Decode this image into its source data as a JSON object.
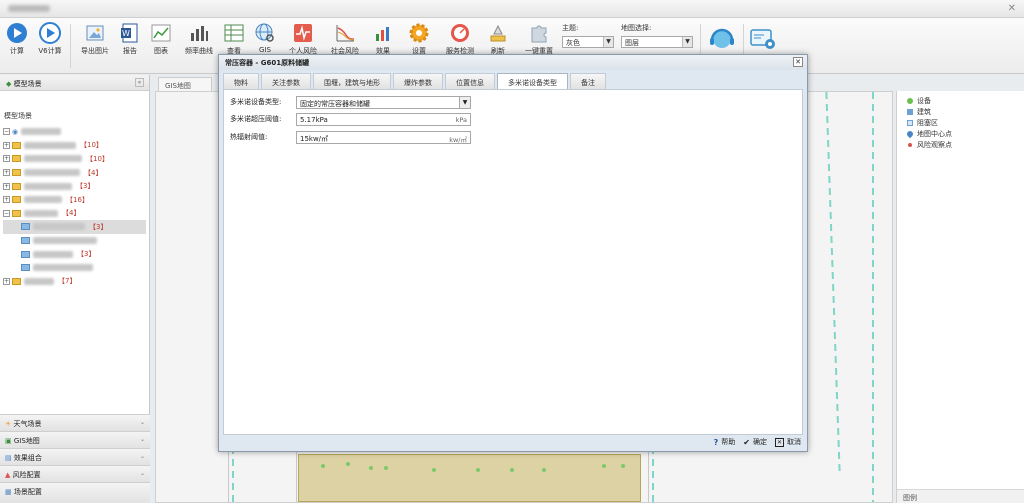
{
  "toolbar": {
    "items": [
      {
        "label": "计算",
        "icon": "play-icon"
      },
      {
        "label": "V6计算",
        "icon": "play-icon"
      },
      {
        "label": "导出图片",
        "icon": "image-icon"
      },
      {
        "label": "报告",
        "icon": "word-icon"
      },
      {
        "label": "图表",
        "icon": "chart-icon"
      },
      {
        "label": "频率曲线",
        "icon": "bar-chart-icon"
      },
      {
        "label": "查看",
        "icon": "table-icon"
      },
      {
        "label": "GIS",
        "icon": "globe-icon"
      },
      {
        "label": "个人风险",
        "icon": "pulse-icon"
      },
      {
        "label": "社会风险",
        "icon": "curve-icon"
      },
      {
        "label": "效果",
        "icon": "effect-icon"
      },
      {
        "label": "设置",
        "icon": "gear-icon"
      },
      {
        "label": "服务检测",
        "icon": "speedometer-icon"
      },
      {
        "label": "刷新",
        "icon": "refresh-icon"
      },
      {
        "label": "一键重置",
        "icon": "puzzle-icon"
      }
    ],
    "theme_label": "主题:",
    "theme_value": "灰色",
    "map_label": "地图选择:",
    "map_value": "图层"
  },
  "left_panel": {
    "header": "模型场景",
    "tree_title": "模型场景",
    "counts": [
      "10",
      "10",
      "4",
      "3",
      "16",
      "4",
      "3",
      "3",
      "7"
    ],
    "accordion": [
      "天气场景",
      "GIS地图",
      "效果组合",
      "风险配置",
      "场景配置"
    ]
  },
  "map": {
    "tab": "GIS地图"
  },
  "legend": {
    "items": [
      {
        "label": "设备",
        "color": "#6bbf4d"
      },
      {
        "label": "建筑",
        "color": "#6fa0d4"
      },
      {
        "label": "阻塞区",
        "color": "#6fa0d4"
      },
      {
        "label": "地图中心点",
        "color": "#4a86c5"
      },
      {
        "label": "风险观察点",
        "color": "#d9534f"
      }
    ],
    "footer": "图例"
  },
  "dialog": {
    "title": "常压容器 - G601原料储罐",
    "tabs": [
      "物料",
      "关注参数",
      "围堰，建筑与地形",
      "爆炸参数",
      "位置信息",
      "多米诺设备类型",
      "备注"
    ],
    "active_tab": 5,
    "fields": [
      {
        "label": "多米诺设备类型:",
        "value": "固定的常压容器和储罐",
        "unit": ""
      },
      {
        "label": "多米诺超压阈值:",
        "value": "5.17kPa",
        "unit": "kPa"
      },
      {
        "label": "热辐射阈值:",
        "value": "15kw/㎡",
        "unit": "kw/㎡"
      }
    ],
    "buttons": {
      "help": "帮助",
      "ok": "确定",
      "cancel": "取消"
    }
  }
}
